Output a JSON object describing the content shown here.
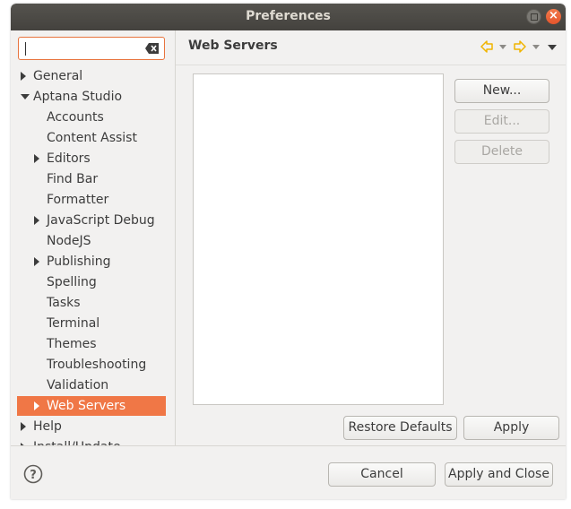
{
  "window": {
    "title": "Preferences"
  },
  "filter": {
    "value": "",
    "placeholder": ""
  },
  "tree": [
    {
      "label": "General",
      "expander": "right",
      "level": 0,
      "selected": false
    },
    {
      "label": "Aptana Studio",
      "expander": "down",
      "level": 0,
      "selected": false
    },
    {
      "label": "Accounts",
      "expander": "none",
      "level": 1,
      "selected": false
    },
    {
      "label": "Content Assist",
      "expander": "none",
      "level": 1,
      "selected": false
    },
    {
      "label": "Editors",
      "expander": "right",
      "level": 1,
      "selected": false
    },
    {
      "label": "Find Bar",
      "expander": "none",
      "level": 1,
      "selected": false
    },
    {
      "label": "Formatter",
      "expander": "none",
      "level": 1,
      "selected": false
    },
    {
      "label": "JavaScript Debug",
      "expander": "right",
      "level": 1,
      "selected": false
    },
    {
      "label": "NodeJS",
      "expander": "none",
      "level": 1,
      "selected": false
    },
    {
      "label": "Publishing",
      "expander": "right",
      "level": 1,
      "selected": false
    },
    {
      "label": "Spelling",
      "expander": "none",
      "level": 1,
      "selected": false
    },
    {
      "label": "Tasks",
      "expander": "none",
      "level": 1,
      "selected": false
    },
    {
      "label": "Terminal",
      "expander": "none",
      "level": 1,
      "selected": false
    },
    {
      "label": "Themes",
      "expander": "none",
      "level": 1,
      "selected": false
    },
    {
      "label": "Troubleshooting",
      "expander": "none",
      "level": 1,
      "selected": false
    },
    {
      "label": "Validation",
      "expander": "none",
      "level": 1,
      "selected": false
    },
    {
      "label": "Web Servers",
      "expander": "right",
      "level": 1,
      "selected": true
    },
    {
      "label": "Help",
      "expander": "right",
      "level": 0,
      "selected": false
    },
    {
      "label": "Install/Update",
      "expander": "right",
      "level": 0,
      "selected": false
    }
  ],
  "page": {
    "title": "Web Servers",
    "buttons": {
      "new": "New...",
      "edit": "Edit...",
      "delete": "Delete"
    },
    "restore_defaults": "Restore Defaults",
    "apply": "Apply"
  },
  "footer": {
    "cancel": "Cancel",
    "apply_and_close": "Apply and Close"
  },
  "colors": {
    "accent": "#f07746",
    "titlebar": "#4b4944",
    "nav_arrow": "#f0b400"
  },
  "icons": {
    "clear": "clear-text-icon",
    "back": "back-arrow-icon",
    "forward": "forward-arrow-icon",
    "menu": "view-menu-icon",
    "help": "help-icon"
  }
}
